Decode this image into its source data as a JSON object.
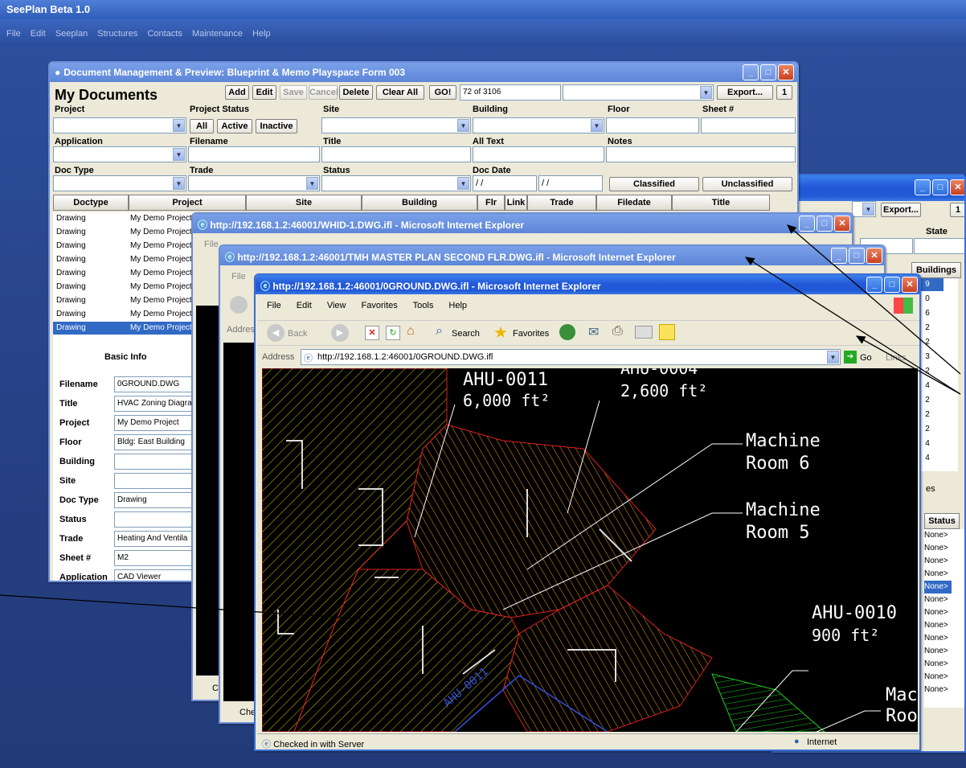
{
  "app": {
    "title": "SeePlan Beta 1.0",
    "menu": [
      "File",
      "Edit",
      "Seeplan",
      "Structures",
      "Contacts",
      "Maintenance",
      "Help"
    ]
  },
  "back_window": {
    "export_label": "Export...",
    "page_num": "1",
    "state_label": "State",
    "buildings_header": "Buildings",
    "buildings_values": [
      "9",
      "0",
      "6",
      "2",
      "2",
      "3",
      "2",
      "4",
      "2",
      "2",
      "2",
      "4",
      "4"
    ],
    "status_header": "Status",
    "status_values": [
      "None>",
      "None>",
      "None>",
      "None>",
      "None>",
      "None>",
      "None>",
      "None>",
      "None>",
      "None>",
      "None>",
      "None>",
      "None>"
    ],
    "es_label": "es"
  },
  "docmgr": {
    "title": "Document Management & Preview: Blueprint & Memo Playspace Form 003",
    "heading": "My Documents",
    "buttons": {
      "add": "Add",
      "edit": "Edit",
      "save": "Save",
      "cancel": "Cancel",
      "delete": "Delete",
      "clear_all": "Clear All",
      "go": "GO!",
      "export": "Export...",
      "page": "1"
    },
    "record_count": "72 of 3106",
    "labels": {
      "project": "Project",
      "project_status": "Project Status",
      "site": "Site",
      "building": "Building",
      "floor": "Floor",
      "sheet": "Sheet #",
      "application": "Application",
      "filename": "Filename",
      "title": "Title",
      "all_text": "All Text",
      "notes": "Notes",
      "doc_type": "Doc Type",
      "trade": "Trade",
      "status": "Status",
      "doc_date": "Doc Date"
    },
    "status_buttons": {
      "all": "All",
      "active": "Active",
      "inactive": "Inactive"
    },
    "date_from": "/ /",
    "date_to": "/ /",
    "classified": "Classified",
    "unclassified": "Unclassified",
    "columns": [
      "Doctype",
      "Project",
      "Site",
      "Building",
      "Flr",
      "Link",
      "Trade",
      "Filedate",
      "Title"
    ],
    "rows": [
      {
        "doctype": "Drawing",
        "project": "My Demo Project"
      },
      {
        "doctype": "Drawing",
        "project": "My Demo Project"
      },
      {
        "doctype": "Drawing",
        "project": "My Demo Project"
      },
      {
        "doctype": "Drawing",
        "project": "My Demo Project"
      },
      {
        "doctype": "Drawing",
        "project": "My Demo Project"
      },
      {
        "doctype": "Drawing",
        "project": "My Demo Project"
      },
      {
        "doctype": "Drawing",
        "project": "My Demo Project"
      },
      {
        "doctype": "Drawing",
        "project": "My Demo Project"
      },
      {
        "doctype": "Drawing",
        "project": "My Demo Project"
      }
    ],
    "basic_info": {
      "heading": "Basic Info",
      "fields": [
        {
          "label": "Filename",
          "value": "0GROUND.DWG"
        },
        {
          "label": "Title",
          "value": "HVAC Zoning Diagram"
        },
        {
          "label": "Project",
          "value": "My Demo Project"
        },
        {
          "label": "Floor",
          "value": "Bldg: East Building"
        },
        {
          "label": "Building",
          "value": ""
        },
        {
          "label": "Site",
          "value": ""
        },
        {
          "label": "Doc Type",
          "value": "Drawing"
        },
        {
          "label": "Status",
          "value": ""
        },
        {
          "label": "Trade",
          "value": "Heating And Ventila"
        },
        {
          "label": "Sheet #",
          "value": "M2"
        },
        {
          "label": "Application",
          "value": "CAD Viewer"
        }
      ]
    }
  },
  "ie1": {
    "title": "http://192.168.1.2:46001/WHID-1.DWG.ifl - Microsoft Internet Explorer",
    "menu_file": "File",
    "status": "C"
  },
  "ie2": {
    "title": "http://192.168.1.2:46001/TMH MASTER PLAN SECOND FLR.DWG.ifl - Microsoft Internet Explorer",
    "menu_file": "File",
    "address": "Addres",
    "status": "Che"
  },
  "ie3": {
    "title": "http://192.168.1.2:46001/0GROUND.DWG.ifl - Microsoft Internet Explorer",
    "menu": [
      "File",
      "Edit",
      "View",
      "Favorites",
      "Tools",
      "Help"
    ],
    "toolbar": {
      "back": "Back",
      "search": "Search",
      "favorites": "Favorites"
    },
    "address_label": "Address",
    "address": "http://192.168.1.2:46001/0GROUND.DWG.ifl",
    "go": "Go",
    "links": "Links",
    "status": "Checked in with Server",
    "zone": "Internet",
    "cad": {
      "ahu11": "AHU-0011",
      "ahu11_area": "6,000 ft²",
      "ahu_top": "AHU-0004",
      "ahu_top_area": "2,600 ft²",
      "mr6_a": "Machine",
      "mr6_b": "Room 6",
      "mr5_a": "Machine",
      "mr5_b": "Room 5",
      "ahu10": "AHU-0010",
      "ahu10_area": "900 ft²",
      "mac": "Mac",
      "roo": "Roo",
      "blue": "AHU-0011"
    }
  }
}
